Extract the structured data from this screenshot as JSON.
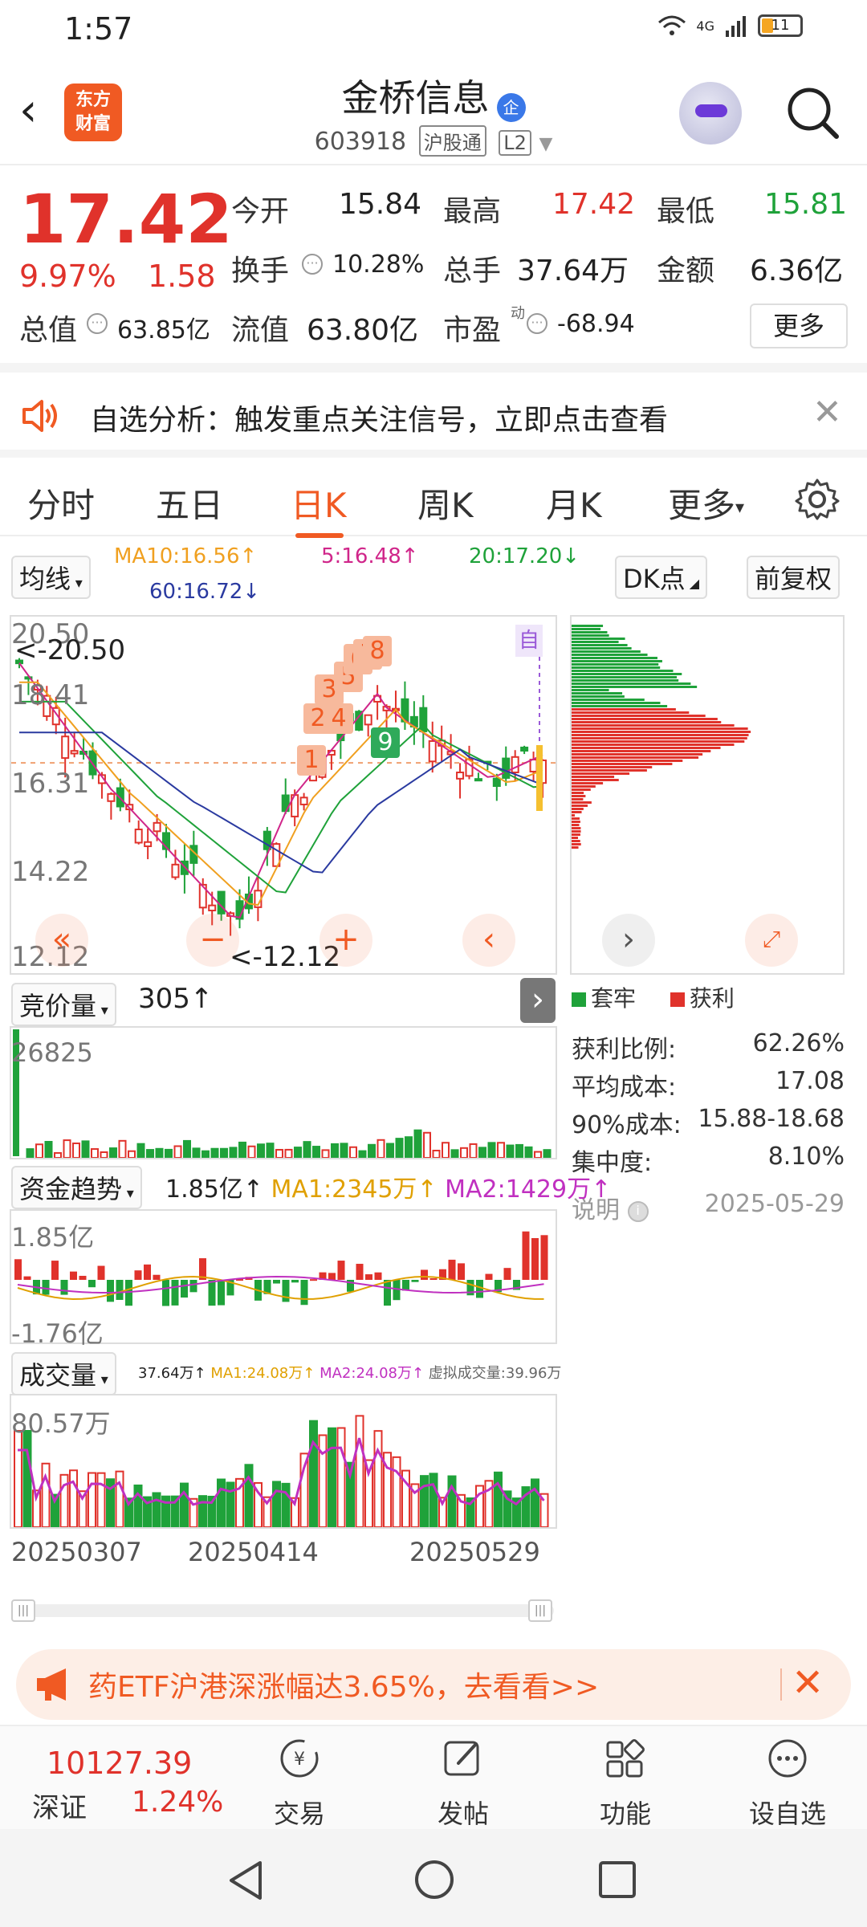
{
  "status": {
    "time": "1:57",
    "network": "4G",
    "battery": "11"
  },
  "header": {
    "logo_line1": "东方",
    "logo_line2": "财富",
    "title": "金桥信息",
    "title_badge": "企",
    "code": "603918",
    "tag1": "沪股通",
    "tag2": "L2"
  },
  "quote": {
    "price": "17.42",
    "pct": "9.97%",
    "change": "1.58",
    "open_label": "今开",
    "open": "15.84",
    "high_label": "最高",
    "high": "17.42",
    "low_label": "最低",
    "low": "15.81",
    "turnover_label": "换手",
    "turnover": "10.28%",
    "volume_label": "总手",
    "volume": "37.64万",
    "amount_label": "金额",
    "amount": "6.36亿",
    "mktcap_label": "总值",
    "mktcap": "63.85亿",
    "float_label": "流值",
    "float": "63.80亿",
    "pe_label": "市盈",
    "pe_sup": "动",
    "pe": "-68.94",
    "more": "更多"
  },
  "banner": {
    "text": "自选分析：触发重点关注信号，立即点击查看"
  },
  "tabs": [
    {
      "label": "分时"
    },
    {
      "label": "五日"
    },
    {
      "label": "日K"
    },
    {
      "label": "周K"
    },
    {
      "label": "月K"
    },
    {
      "label": "更多"
    }
  ],
  "ma": {
    "selector": "均线",
    "ma10": "MA10:16.56↑",
    "ma5": "5:16.48↑",
    "ma20": "20:17.20↓",
    "ma60": "60:16.72↓",
    "dk": "DK点",
    "adjust": "前复权"
  },
  "kline": {
    "y_labels": [
      "20.50",
      "18.41",
      "16.31",
      "14.22",
      "12.12"
    ],
    "max_marker": "<-20.50",
    "min_marker": "<-12.12",
    "self_tag": "自",
    "td_numbers": [
      "1",
      "2",
      "3",
      "4",
      "5",
      "6",
      "7",
      "8",
      "9"
    ]
  },
  "chip": {
    "legend_trapped": "套牢",
    "legend_profit": "获利",
    "stats": [
      {
        "label": "获利比例:",
        "value": "62.26%"
      },
      {
        "label": "平均成本:",
        "value": "17.08"
      },
      {
        "label": "90%成本:",
        "value": "15.88-18.68"
      },
      {
        "label": "集中度:",
        "value": "8.10%"
      }
    ],
    "note_label": "说明",
    "date": "2025-05-29"
  },
  "auction": {
    "selector": "竞价量",
    "value": "305↑",
    "y_top": "26825"
  },
  "fund": {
    "selector": "资金趋势",
    "value": "1.85亿↑",
    "ma1": "MA1:2345万↑",
    "ma2": "MA2:1429万↑",
    "y_top": "1.85亿",
    "y_bottom": "-1.76亿"
  },
  "volume": {
    "selector": "成交量",
    "value": "37.64万↑",
    "ma1": "MA1:24.08万↑",
    "ma2": "MA2:24.08万↑",
    "virtual": "虚拟成交量:39.96万",
    "y_top": "80.57万",
    "dates": [
      "20250307",
      "20250414",
      "20250529"
    ]
  },
  "ad": {
    "text": "药ETF沪港深涨幅达3.65%，去看看>>"
  },
  "bottom": {
    "index_value": "10127.39",
    "index_name": "深证",
    "index_pct": "1.24%",
    "trade": "交易",
    "post": "发帖",
    "features": "功能",
    "watch": "设自选"
  },
  "colors": {
    "up": "#e0322b",
    "down": "#1fa23a",
    "accent": "#f05a23"
  }
}
